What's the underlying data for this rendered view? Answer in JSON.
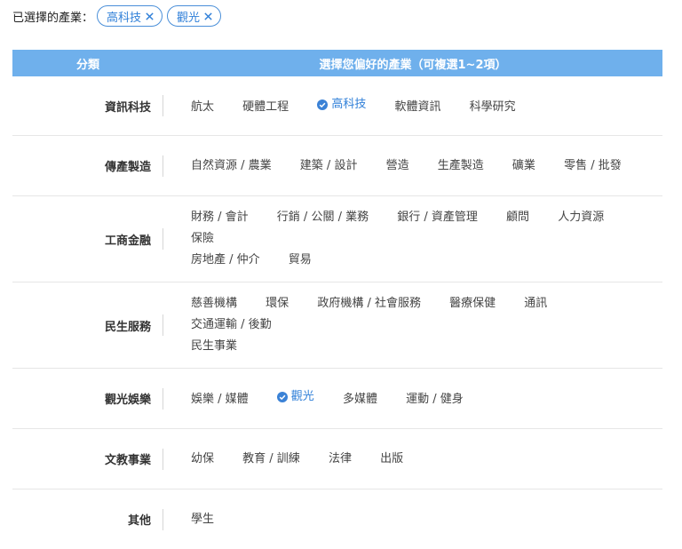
{
  "selected": {
    "label": "已選擇的產業：",
    "chips": [
      {
        "label": "高科技",
        "remove_icon": "close-icon"
      },
      {
        "label": "觀光",
        "remove_icon": "close-icon"
      }
    ]
  },
  "table": {
    "header_category": "分類",
    "header_options": "選擇您偏好的產業（可複選1~2項）",
    "rows": [
      {
        "category": "資訊科技",
        "options": [
          "航太",
          "硬體工程",
          "高科技",
          "軟體資訊",
          "科學研究"
        ]
      },
      {
        "category": "傳產製造",
        "options": [
          "自然資源 / 農業",
          "建築 / 設計",
          "營造",
          "生產製造",
          "礦業",
          "零售 / 批發"
        ]
      },
      {
        "category": "工商金融",
        "options": [
          "財務 / 會計",
          "行銷 / 公關 / 業務",
          "銀行 / 資產管理",
          "顧問",
          "人力資源",
          "保險",
          "房地產 / 仲介",
          "貿易"
        ]
      },
      {
        "category": "民生服務",
        "options": [
          "慈善機構",
          "環保",
          "政府機構 / 社會服務",
          "醫療保健",
          "通訊",
          "交通運輸 / 後勤",
          "民生事業"
        ]
      },
      {
        "category": "觀光娛樂",
        "options": [
          "娛樂 / 媒體",
          "觀光",
          "多媒體",
          "運動 / 健身"
        ]
      },
      {
        "category": "文教事業",
        "options": [
          "幼保",
          "教育 / 訓練",
          "法律",
          "出版"
        ]
      },
      {
        "category": "其他",
        "options": [
          "學生"
        ]
      }
    ]
  },
  "colors": {
    "accent": "#2f7fd8",
    "header_bg": "#6fb0ec",
    "check_bg": "#3b82d6"
  }
}
